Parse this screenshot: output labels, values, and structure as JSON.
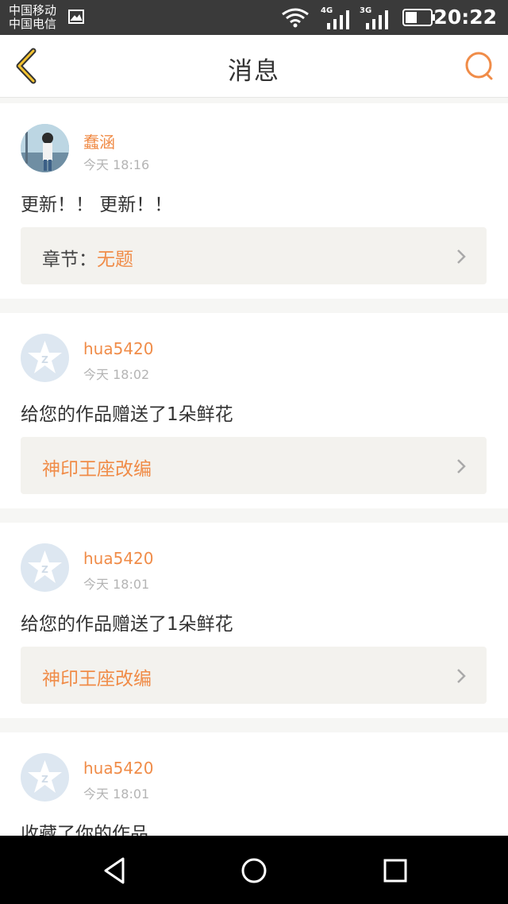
{
  "status_bar": {
    "carrier_1": "中国移动",
    "carrier_2": "中国电信",
    "network_1": "4G",
    "network_2": "3G",
    "time": "20:22",
    "icons": [
      "gallery-icon",
      "wifi-icon",
      "signal-icon",
      "signal-icon",
      "battery-icon"
    ],
    "battery_level": 0.45
  },
  "header": {
    "title": "消息",
    "back_icon": "chevron-left-icon",
    "search_icon": "search-icon",
    "accent_color": "#f08c48"
  },
  "notifications": [
    {
      "username": "蠢涵",
      "time": "今天 18:16",
      "message": "更新！！ 更新！！",
      "link_prefix": "章节：",
      "link_value": "无题",
      "avatar": "user-photo"
    },
    {
      "username": "hua5420",
      "time": "今天 18:02",
      "message": "给您的作品赠送了1朵鲜花",
      "link_prefix": "",
      "link_value": "神印王座改编",
      "avatar": "default-star-avatar"
    },
    {
      "username": "hua5420",
      "time": "今天 18:01",
      "message": "给您的作品赠送了1朵鲜花",
      "link_prefix": "",
      "link_value": "神印王座改编",
      "avatar": "default-star-avatar"
    },
    {
      "username": "hua5420",
      "time": "今天 18:01",
      "message": "收藏了你的作品",
      "avatar": "default-star-avatar"
    }
  ],
  "nav_bar": {
    "icons": [
      "back-triangle-icon",
      "home-circle-icon",
      "recents-square-icon"
    ]
  }
}
